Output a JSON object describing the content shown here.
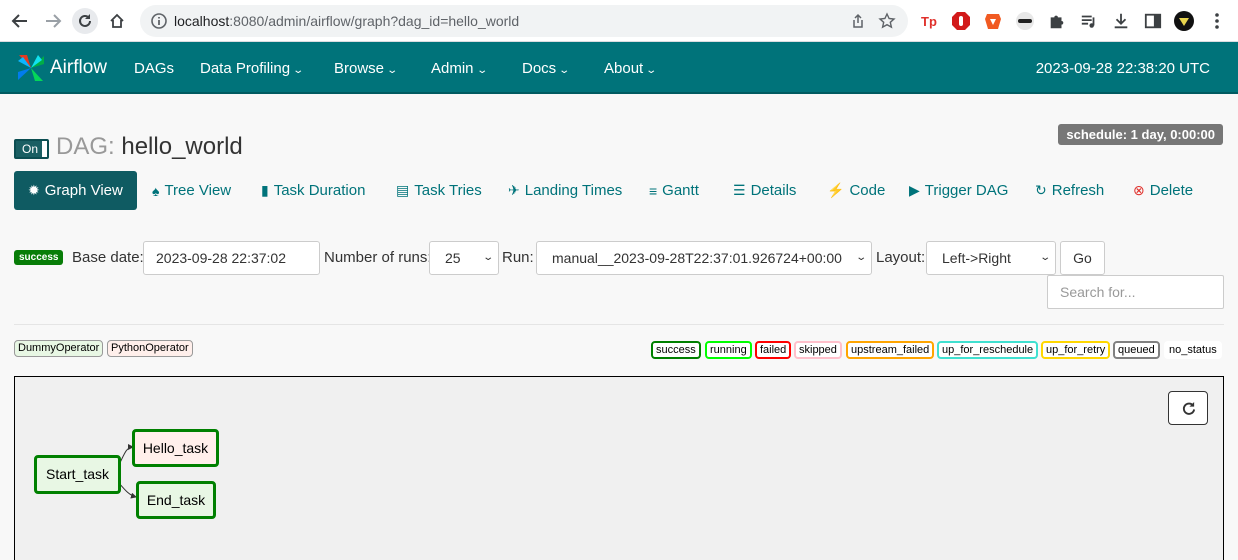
{
  "browser": {
    "url_host": "localhost",
    "url_rest": ":8080/admin/airflow/graph?dag_id=hello_world",
    "extensions": [
      "tp-icon",
      "stop-icon",
      "brave-icon",
      "incognito-icon",
      "puzzle-icon",
      "queue-icon",
      "download-icon",
      "sidebar-icon",
      "profile-icon",
      "more-icon"
    ]
  },
  "navbar": {
    "brand": "Airflow",
    "items": [
      {
        "label": "DAGs",
        "caret": false
      },
      {
        "label": "Data Profiling",
        "caret": true
      },
      {
        "label": "Browse",
        "caret": true
      },
      {
        "label": "Admin",
        "caret": true
      },
      {
        "label": "Docs",
        "caret": true
      },
      {
        "label": "About",
        "caret": true
      }
    ],
    "clock": "2023-09-28 22:38:20 UTC"
  },
  "dag": {
    "toggle_label": "On",
    "title_label": "DAG:",
    "name": "hello_world",
    "schedule": "schedule: 1 day, 0:00:00"
  },
  "tabs": [
    {
      "label": "Graph View",
      "icon": "sun-icon",
      "glyph": "✹",
      "active": true
    },
    {
      "label": "Tree View",
      "icon": "tree-icon",
      "glyph": "♠",
      "active": false
    },
    {
      "label": "Task Duration",
      "icon": "bar-chart-icon",
      "glyph": "▮",
      "active": false
    },
    {
      "label": "Task Tries",
      "icon": "files-icon",
      "glyph": "▤",
      "active": false
    },
    {
      "label": "Landing Times",
      "icon": "plane-icon",
      "glyph": "✈",
      "active": false
    },
    {
      "label": "Gantt",
      "icon": "align-left-icon",
      "glyph": "≡",
      "active": false
    },
    {
      "label": "Details",
      "icon": "list-icon",
      "glyph": "☰",
      "active": false
    },
    {
      "label": "Code",
      "icon": "flash-icon",
      "glyph": "⚡",
      "active": false
    },
    {
      "label": "Trigger DAG",
      "icon": "play-circle-icon",
      "glyph": "▶",
      "active": false
    },
    {
      "label": "Refresh",
      "icon": "refresh-icon",
      "glyph": "↻",
      "active": false
    },
    {
      "label": "Delete",
      "icon": "remove-circle-icon",
      "glyph": "⊗",
      "active": false
    }
  ],
  "form": {
    "state_badge": "success",
    "base_date_label": "Base date:",
    "base_date_value": "2023-09-28 22:37:02",
    "num_runs_label": "Number of runs:",
    "num_runs_value": "25",
    "run_label": "Run:",
    "run_value": "manual__2023-09-28T22:37:01.926724+00:00",
    "layout_label": "Layout:",
    "layout_value": "Left->Right",
    "go_label": "Go",
    "search_placeholder": "Search for..."
  },
  "operators": [
    {
      "label": "DummyOperator",
      "color": "#e8f7e4"
    },
    {
      "label": "PythonOperator",
      "color": "#ffefeb"
    }
  ],
  "states": [
    {
      "label": "success",
      "color": "#008000"
    },
    {
      "label": "running",
      "color": "#00ff00"
    },
    {
      "label": "failed",
      "color": "#ff0000"
    },
    {
      "label": "skipped",
      "color": "#ffc0cb"
    },
    {
      "label": "upstream_failed",
      "color": "#ffa500"
    },
    {
      "label": "up_for_reschedule",
      "color": "#40e0d0"
    },
    {
      "label": "up_for_retry",
      "color": "#ffd700"
    },
    {
      "label": "queued",
      "color": "#808080"
    },
    {
      "label": "no_status",
      "color": "#ffffff"
    }
  ],
  "graph": {
    "nodes": [
      {
        "id": "start",
        "label": "Start_task",
        "fill": "#e8f7e4",
        "state_color": "#008000"
      },
      {
        "id": "hello",
        "label": "Hello_task",
        "fill": "#ffefeb",
        "state_color": "#008000"
      },
      {
        "id": "end",
        "label": "End_task",
        "fill": "#e8f7e4",
        "state_color": "#008000"
      }
    ],
    "edges": [
      {
        "from": "start",
        "to": "hello"
      },
      {
        "from": "start",
        "to": "end"
      }
    ]
  }
}
